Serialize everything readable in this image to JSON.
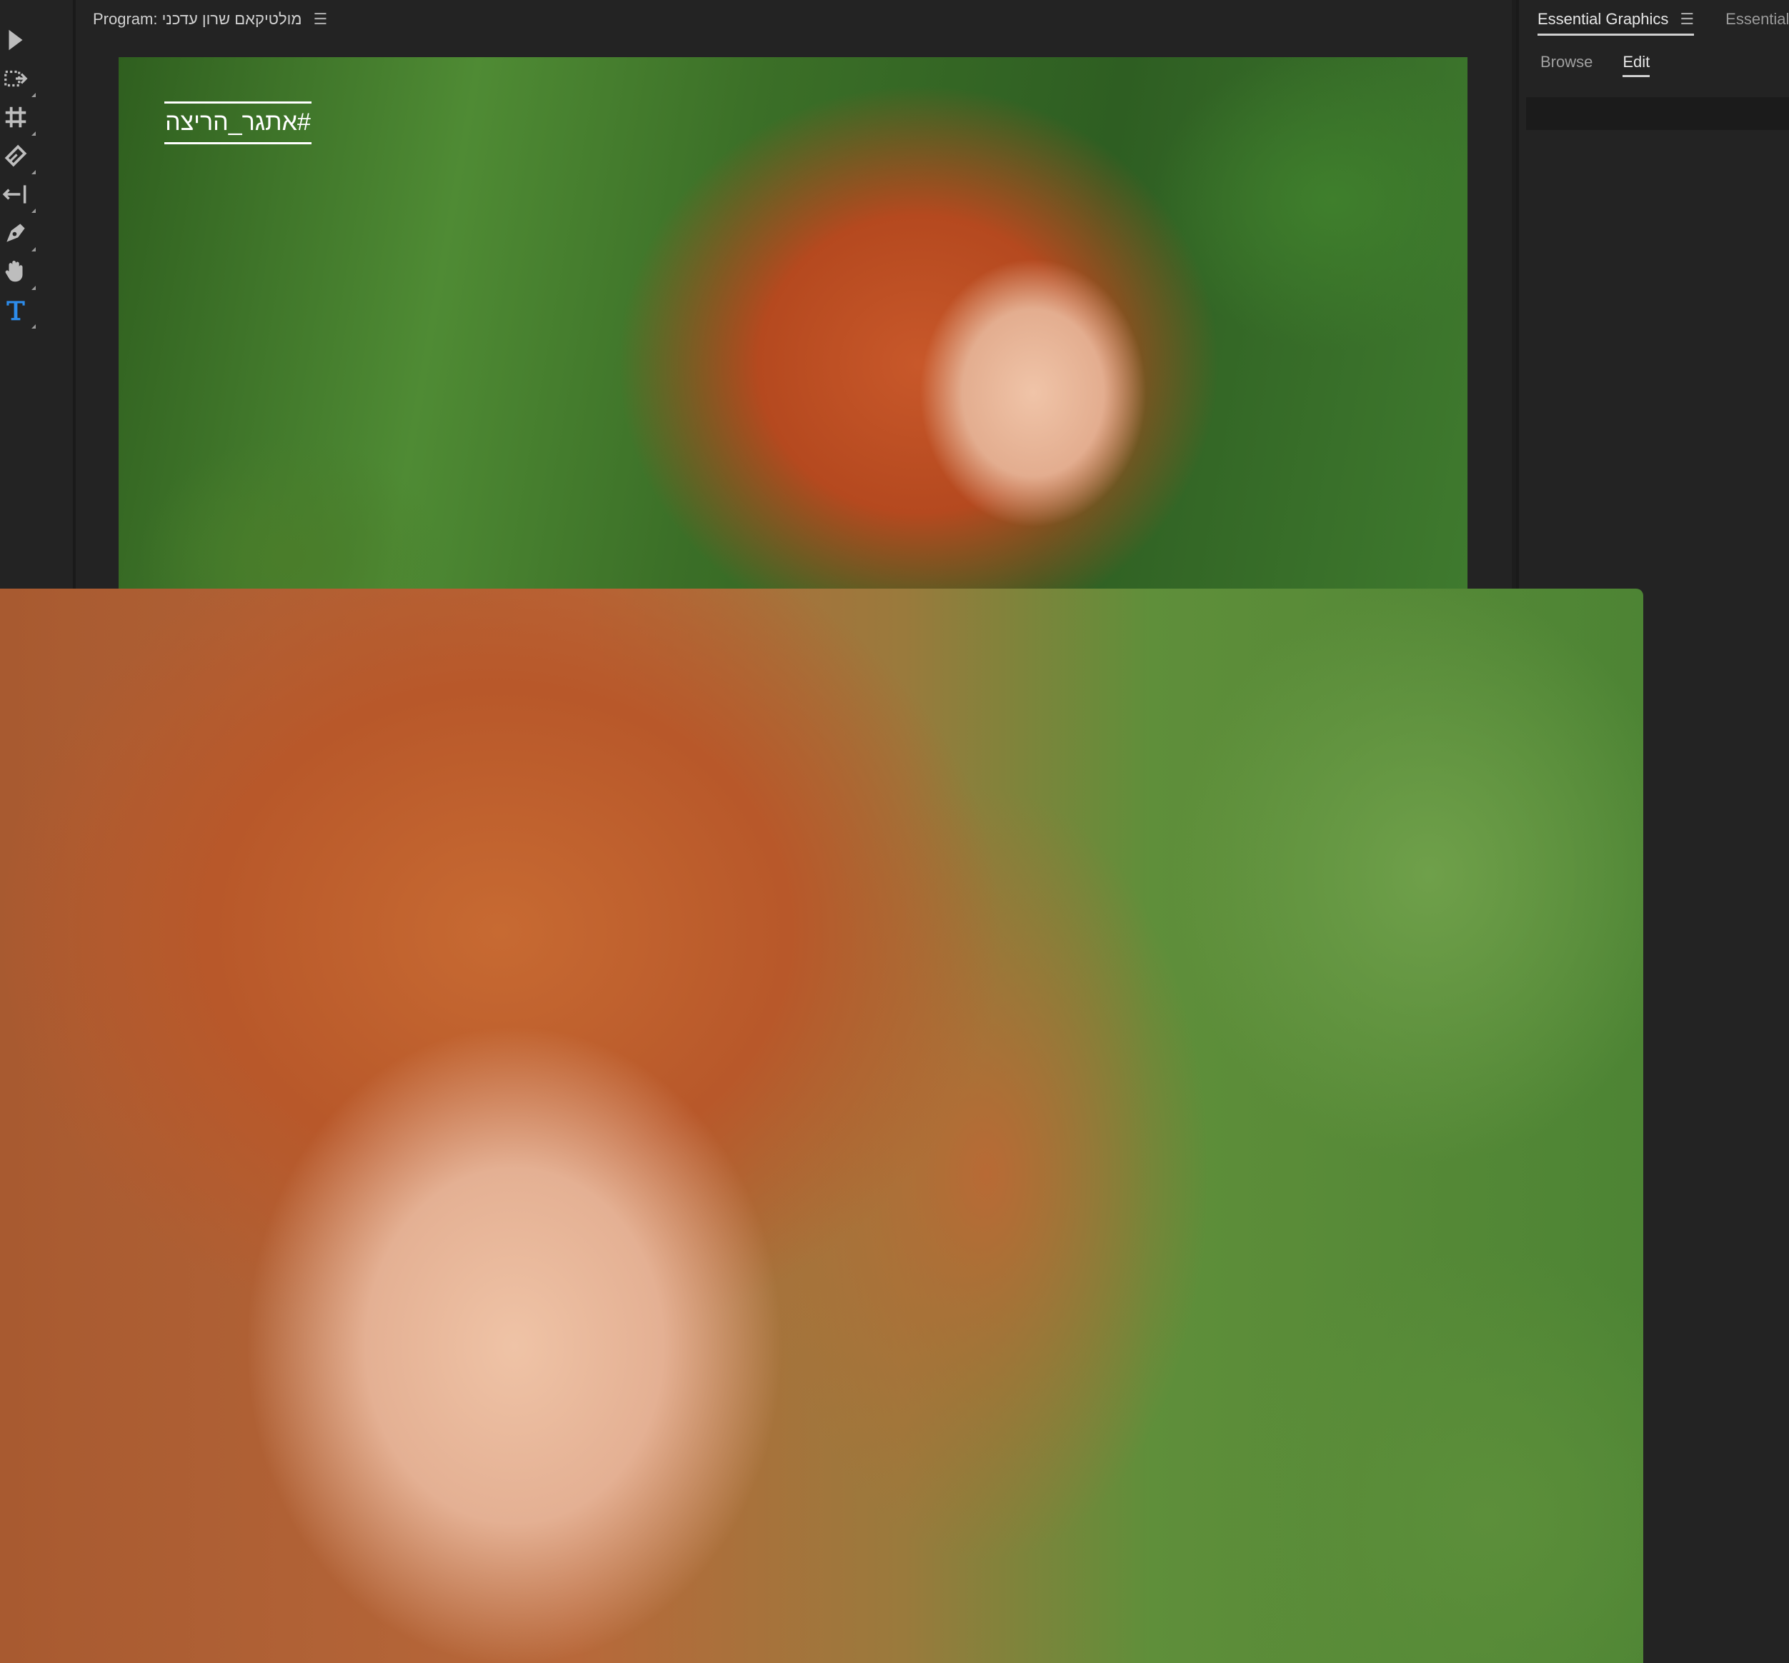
{
  "program_monitor": {
    "title": "Program: מולטיקאם שרון עדכני",
    "menu_glyph": "☰",
    "overlay_text": "#אתגר_הריצה"
  },
  "tools": [
    {
      "name": "selection-tool-icon",
      "active": false
    },
    {
      "name": "track-select-tool-icon",
      "active": false
    },
    {
      "name": "ripple-edit-tool-icon",
      "active": false
    },
    {
      "name": "razor-tool-icon",
      "active": false
    },
    {
      "name": "slip-tool-icon",
      "active": false
    },
    {
      "name": "pen-tool-icon",
      "active": false
    },
    {
      "name": "hand-tool-icon",
      "active": false
    },
    {
      "name": "type-tool-icon",
      "active": true
    }
  ],
  "essential_graphics": {
    "tab_label": "Essential Graphics",
    "menu_glyph": "☰",
    "other_tab_label": "Essential S",
    "subtabs": {
      "browse": "Browse",
      "edit": "Edit"
    }
  },
  "colors": {
    "panel_bg": "#232323",
    "active_tool": "#2d8ceb",
    "overlay_text": "#ffffff"
  }
}
